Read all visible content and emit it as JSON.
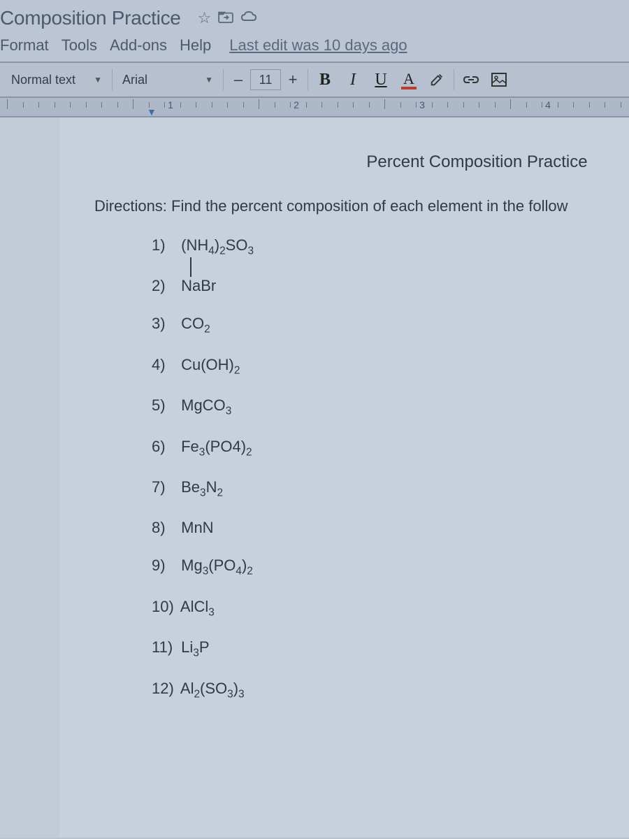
{
  "header": {
    "title": "Composition Practice",
    "star_icon": "star-outline",
    "move_icon": "move-to-folder",
    "cloud_icon": "cloud-saved"
  },
  "menu": {
    "items": [
      "Format",
      "Tools",
      "Add-ons",
      "Help"
    ],
    "last_edit": "Last edit was 10 days ago"
  },
  "toolbar": {
    "style": "Normal text",
    "font": "Arial",
    "size_minus": "–",
    "size": "11",
    "size_plus": "+",
    "bold": "B",
    "italic": "I",
    "underline": "U",
    "textcolor": "A"
  },
  "ruler": {
    "numbers": [
      1,
      2,
      3,
      4
    ]
  },
  "document": {
    "title": "Percent Composition Practice",
    "directions": "Directions: Find the percent composition of each element in the follow",
    "problems": [
      {
        "n": "1)",
        "formula": "(NH<sub>4</sub>)<sub>2</sub>SO<sub>3</sub>"
      },
      {
        "n": "2)",
        "formula": "NaBr"
      },
      {
        "n": "3)",
        "formula": "CO<sub>2</sub>"
      },
      {
        "n": "4)",
        "formula": "Cu(OH)<sub>2</sub>"
      },
      {
        "n": "5)",
        "formula": "MgCO<sub>3</sub>"
      },
      {
        "n": "6)",
        "formula": "Fe<sub>3</sub>(PO4)<sub>2</sub>"
      },
      {
        "n": "7)",
        "formula": "Be<sub>3</sub>N<sub>2</sub>"
      },
      {
        "n": "8)",
        "formula": "MnN"
      },
      {
        "n": "9)",
        "formula": "Mg<sub>3</sub>(PO<sub>4</sub>)<sub>2</sub>"
      },
      {
        "n": "10)",
        "formula": "AlCl<sub>3</sub>"
      },
      {
        "n": "11)",
        "formula": "Li<sub>3</sub>P"
      },
      {
        "n": "12)",
        "formula": "Al<sub>2</sub>(SO<sub>3</sub>)<sub>3</sub>"
      }
    ]
  }
}
